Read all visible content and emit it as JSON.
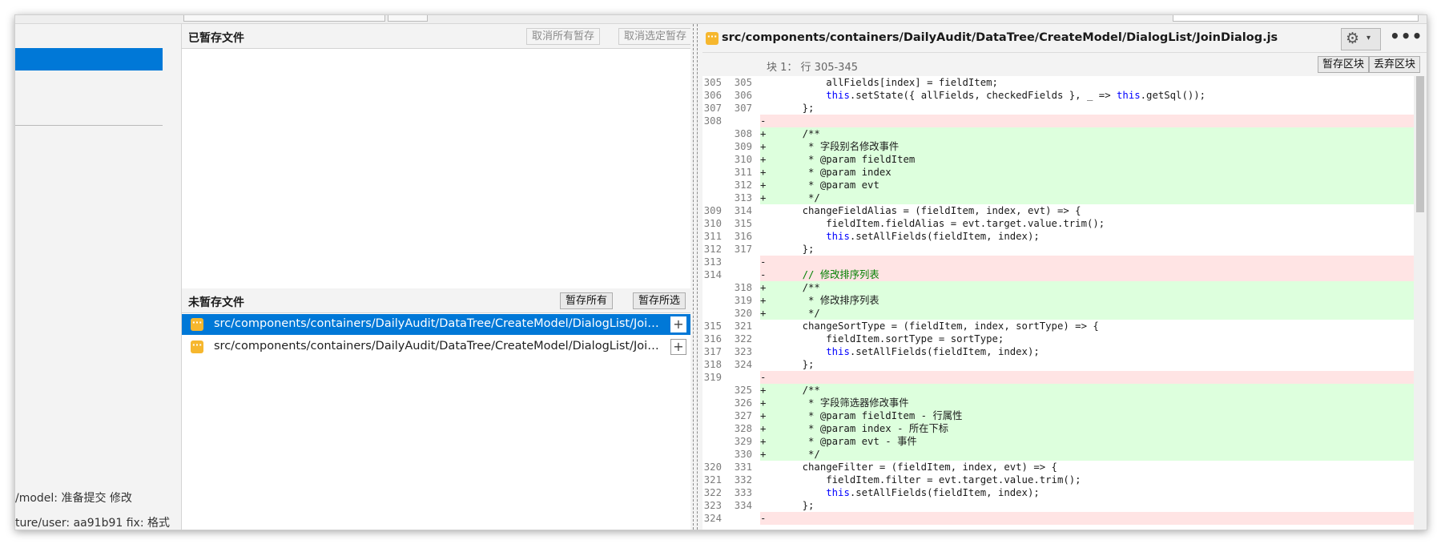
{
  "sidebar": {
    "commits": [
      "/model: 准备提交 修改",
      "ture/user: aa91b91 fix: 格式"
    ]
  },
  "staged": {
    "title": "已暂存文件",
    "unstage_all_label": "取消所有暂存",
    "unstage_selected_label": "取消选定暂存"
  },
  "unstaged": {
    "title": "未暂存文件",
    "stage_all_label": "暂存所有",
    "stage_selected_label": "暂存所选",
    "files": [
      {
        "path": "src/components/containers/DailyAudit/DataTree/CreateModel/DialogList/JoinDialog.js",
        "icon": "modified-file-icon",
        "selected": true
      },
      {
        "path": "src/components/containers/DailyAudit/DataTree/CreateModel/DialogList/JoinDialog.js",
        "icon": "modified-file-icon",
        "selected": false
      }
    ]
  },
  "diff": {
    "file_path": "src/components/containers/DailyAudit/DataTree/CreateModel/DialogList/JoinDialog.js",
    "hunk_label": "块 1： 行 305-345",
    "stage_hunk_label": "暂存区块",
    "discard_hunk_label": "丢弃区块",
    "more_label": "•••",
    "lines": [
      {
        "t": "ctx",
        "o": "305",
        "n": "305",
        "s": "",
        "c": "        allFields[index] = fieldItem;"
      },
      {
        "t": "ctx",
        "o": "306",
        "n": "306",
        "s": "",
        "c": "        this.setState({ allFields, checkedFields }, _ => this.getSql());"
      },
      {
        "t": "ctx",
        "o": "307",
        "n": "307",
        "s": "",
        "c": "    };"
      },
      {
        "t": "del",
        "o": "308",
        "n": "",
        "s": "-",
        "c": ""
      },
      {
        "t": "add",
        "o": "",
        "n": "308",
        "s": "+",
        "c": "    /**"
      },
      {
        "t": "add",
        "o": "",
        "n": "309",
        "s": "+",
        "c": "     * 字段别名修改事件"
      },
      {
        "t": "add",
        "o": "",
        "n": "310",
        "s": "+",
        "c": "     * @param fieldItem"
      },
      {
        "t": "add",
        "o": "",
        "n": "311",
        "s": "+",
        "c": "     * @param index"
      },
      {
        "t": "add",
        "o": "",
        "n": "312",
        "s": "+",
        "c": "     * @param evt"
      },
      {
        "t": "add",
        "o": "",
        "n": "313",
        "s": "+",
        "c": "     */"
      },
      {
        "t": "ctx",
        "o": "309",
        "n": "314",
        "s": "",
        "c": "    changeFieldAlias = (fieldItem, index, evt) => {"
      },
      {
        "t": "ctx",
        "o": "310",
        "n": "315",
        "s": "",
        "c": "        fieldItem.fieldAlias = evt.target.value.trim();"
      },
      {
        "t": "ctx",
        "o": "311",
        "n": "316",
        "s": "",
        "c": "        this.setAllFields(fieldItem, index);"
      },
      {
        "t": "ctx",
        "o": "312",
        "n": "317",
        "s": "",
        "c": "    };"
      },
      {
        "t": "del",
        "o": "313",
        "n": "",
        "s": "-",
        "c": ""
      },
      {
        "t": "del",
        "o": "314",
        "n": "",
        "s": "-",
        "c": "    // 修改排序列表"
      },
      {
        "t": "add",
        "o": "",
        "n": "318",
        "s": "+",
        "c": "    /**"
      },
      {
        "t": "add",
        "o": "",
        "n": "319",
        "s": "+",
        "c": "     * 修改排序列表"
      },
      {
        "t": "add",
        "o": "",
        "n": "320",
        "s": "+",
        "c": "     */"
      },
      {
        "t": "ctx",
        "o": "315",
        "n": "321",
        "s": "",
        "c": "    changeSortType = (fieldItem, index, sortType) => {"
      },
      {
        "t": "ctx",
        "o": "316",
        "n": "322",
        "s": "",
        "c": "        fieldItem.sortType = sortType;"
      },
      {
        "t": "ctx",
        "o": "317",
        "n": "323",
        "s": "",
        "c": "        this.setAllFields(fieldItem, index);"
      },
      {
        "t": "ctx",
        "o": "318",
        "n": "324",
        "s": "",
        "c": "    };"
      },
      {
        "t": "del",
        "o": "319",
        "n": "",
        "s": "-",
        "c": ""
      },
      {
        "t": "add",
        "o": "",
        "n": "325",
        "s": "+",
        "c": "    /**"
      },
      {
        "t": "add",
        "o": "",
        "n": "326",
        "s": "+",
        "c": "     * 字段筛选器修改事件"
      },
      {
        "t": "add",
        "o": "",
        "n": "327",
        "s": "+",
        "c": "     * @param fieldItem - 行属性"
      },
      {
        "t": "add",
        "o": "",
        "n": "328",
        "s": "+",
        "c": "     * @param index - 所在下标"
      },
      {
        "t": "add",
        "o": "",
        "n": "329",
        "s": "+",
        "c": "     * @param evt - 事件"
      },
      {
        "t": "add",
        "o": "",
        "n": "330",
        "s": "+",
        "c": "     */"
      },
      {
        "t": "ctx",
        "o": "320",
        "n": "331",
        "s": "",
        "c": "    changeFilter = (fieldItem, index, evt) => {"
      },
      {
        "t": "ctx",
        "o": "321",
        "n": "332",
        "s": "",
        "c": "        fieldItem.filter = evt.target.value.trim();"
      },
      {
        "t": "ctx",
        "o": "322",
        "n": "333",
        "s": "",
        "c": "        this.setAllFields(fieldItem, index);"
      },
      {
        "t": "ctx",
        "o": "323",
        "n": "334",
        "s": "",
        "c": "    };"
      },
      {
        "t": "del",
        "o": "324",
        "n": "",
        "s": "-",
        "c": ""
      }
    ]
  },
  "colors": {
    "accent": "#0078d7",
    "added_bg": "#ddffdd",
    "removed_bg": "#ffe4e4",
    "file_icon": "#f6b72e",
    "keyword": "#0000ff",
    "comment": "#008000"
  }
}
